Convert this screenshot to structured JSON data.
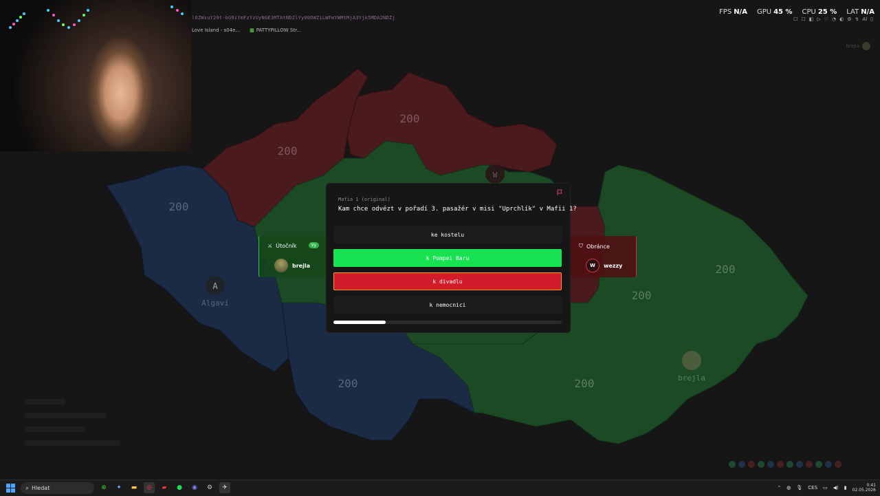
{
  "overlay": {
    "browser_title": "l0ZWxuY29t-bG9iYmFzYzUyNGE3MTAtNDZlYy00OWZiLWFmYWMtMjA3Yjk5MDA2NDZj",
    "tabs": [
      {
        "label": "Love Island - s04e..."
      },
      {
        "label": "PATTYPILLOW Str..."
      }
    ]
  },
  "stats": {
    "fps_label": "FPS",
    "fps_value": "N/A",
    "gpu_label": "GPU",
    "gpu_value": "45 %",
    "cpu_label": "CPU",
    "cpu_value": "25 %",
    "lat_label": "LAT",
    "lat_value": "N/A",
    "tray_icons": [
      "☐",
      "☐",
      "◧",
      "▷",
      "♡",
      "◔",
      "◐",
      "⚙",
      "↯",
      "Al",
      "▯"
    ]
  },
  "top_user": "brejla",
  "map": {
    "regions": [
      {
        "label": "200",
        "team": "red"
      },
      {
        "label": "200",
        "team": "red"
      },
      {
        "label": "200",
        "team": "blue"
      },
      {
        "label": "200",
        "team": "blue"
      },
      {
        "label": "200",
        "team": "green"
      },
      {
        "label": "200",
        "team": "green"
      },
      {
        "label": "200",
        "team": "green"
      }
    ],
    "capital_marker_letter": "A",
    "capital_label": "Algaví",
    "enemy_marker_letter": "W",
    "own_player_label": "brejla",
    "colors": {
      "red": "#4a1a1d",
      "blue": "#1b2a45",
      "green": "#1c4a25",
      "grey": "#2a2a2a"
    }
  },
  "question": {
    "category": "Mafia 1 (original)",
    "text": "Kam chce odvézt v pořadí 3. pasažér v misi \"Uprchlík\" v Mafii 1?",
    "answers": [
      {
        "label": "ke kostelu",
        "state": "neutral"
      },
      {
        "label": "k Pompei Baru",
        "state": "correct"
      },
      {
        "label": "k divadlu",
        "state": "wrong"
      },
      {
        "label": "k nemocnici",
        "state": "neutral"
      }
    ],
    "timer_progress": 0.23
  },
  "attacker": {
    "role": "Útočník",
    "badge": "Vy",
    "name": "brejla"
  },
  "defender": {
    "role": "Obránce",
    "name": "wezzy",
    "avatar_letter": "W"
  },
  "taskbar": {
    "search_placeholder": "Hledat",
    "apps": [
      "xbox",
      "copilot",
      "explorer",
      "opera",
      "app5",
      "spotify",
      "discord",
      "steam",
      "chrome-alt",
      "shield"
    ],
    "lang": "CES",
    "time": "0:41",
    "date": "02.05.2026"
  }
}
